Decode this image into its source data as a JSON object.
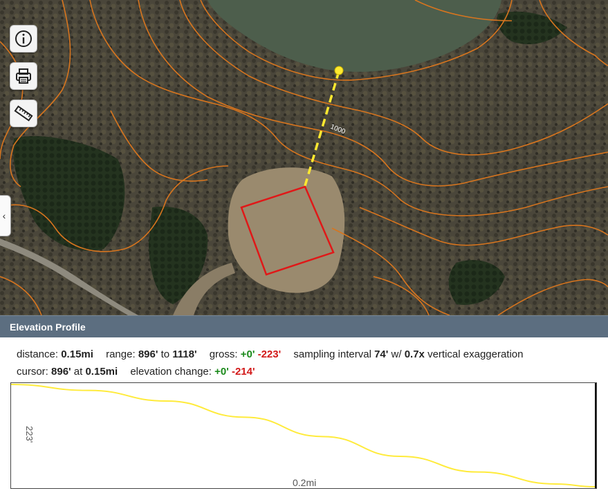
{
  "map": {
    "contour_label": "1000",
    "colors": {
      "contour": "#d8751e",
      "profile_line": "#ffeb3b",
      "site_outline": "#e01818",
      "lake": "#4a5b4a"
    }
  },
  "toolbar": {
    "info_icon": "info-icon",
    "print_icon": "printer-icon",
    "measure_icon": "ruler-icon"
  },
  "side_tab": {
    "label": "‹"
  },
  "panel": {
    "title": "Elevation Profile",
    "stats": {
      "distance_label": "distance:",
      "distance_value": "0.15mi",
      "range_label": "range:",
      "range_min": "896'",
      "range_to": "to",
      "range_max": "1118'",
      "gross_label": "gross:",
      "gross_up": "+0'",
      "gross_down": "-223'",
      "sampling_label": "sampling interval",
      "sampling_value": "74'",
      "with_label": "w/",
      "exaggeration_value": "0.7x",
      "exaggeration_label": "vertical exaggeration",
      "cursor_label": "cursor:",
      "cursor_elev": "896'",
      "at_label": "at",
      "cursor_dist": "0.15mi",
      "change_label": "elevation change:",
      "change_up": "+0'",
      "change_down": "-214'"
    },
    "chart": {
      "y_label": "223'",
      "x_label": "0.2mi"
    }
  },
  "chart_data": {
    "type": "line",
    "x": [
      0,
      0.02,
      0.04,
      0.06,
      0.08,
      0.1,
      0.12,
      0.14,
      0.15
    ],
    "y": [
      1118,
      1105,
      1082,
      1047,
      1005,
      962,
      928,
      902,
      896
    ],
    "xlabel": "0.2mi",
    "ylabel": "223'",
    "ylim": [
      896,
      1118
    ],
    "grid": false
  }
}
